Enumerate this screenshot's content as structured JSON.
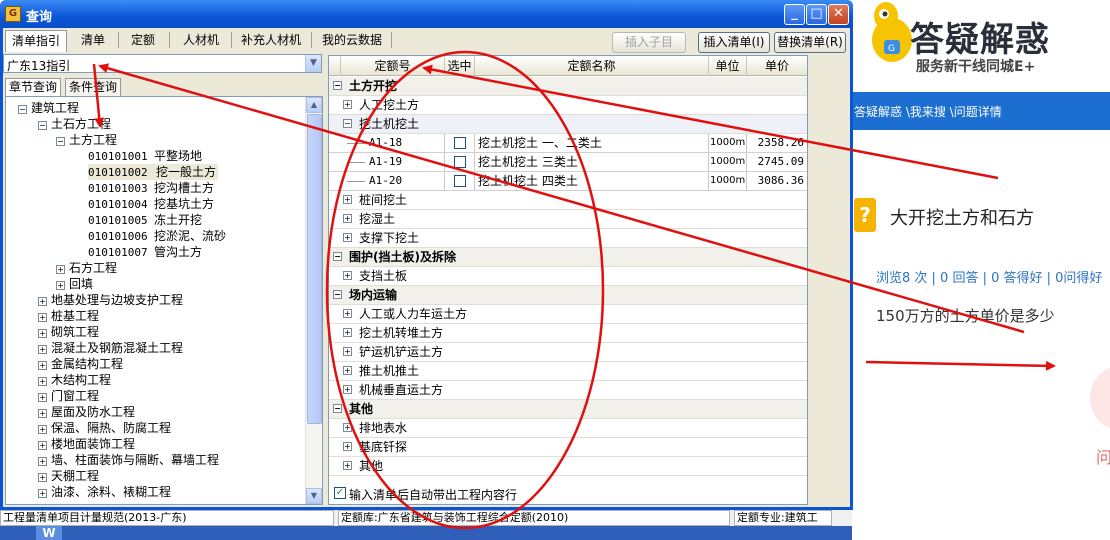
{
  "window": {
    "title": "查询"
  },
  "toolbar": {
    "tabs": [
      "清单指引",
      "清单",
      "定额",
      "人材机",
      "补充人材机",
      "我的云数据"
    ],
    "insert_child": "插入子目",
    "insert_list": "插入清单(I)",
    "replace_list": "替换清单(R)"
  },
  "left": {
    "guide_select": "广东13指引",
    "subtabs": [
      "章节查询",
      "条件查询"
    ],
    "tree": [
      {
        "text": "建筑工程",
        "exp": "−",
        "indent": 0
      },
      {
        "text": "土石方工程",
        "exp": "−",
        "indent": 1
      },
      {
        "text": "土方工程",
        "exp": "−",
        "indent": 2
      },
      {
        "code": "010101001",
        "text": "平整场地",
        "indent": 3
      },
      {
        "code": "010101002",
        "text": "挖一般土方",
        "indent": 3,
        "selected": true
      },
      {
        "code": "010101003",
        "text": "挖沟槽土方",
        "indent": 3
      },
      {
        "code": "010101004",
        "text": "挖基坑土方",
        "indent": 3
      },
      {
        "code": "010101005",
        "text": "冻土开挖",
        "indent": 3
      },
      {
        "code": "010101006",
        "text": "挖淤泥、流砂",
        "indent": 3
      },
      {
        "code": "010101007",
        "text": "管沟土方",
        "indent": 3
      },
      {
        "text": "石方工程",
        "exp": "+",
        "indent": 2
      },
      {
        "text": "回填",
        "exp": "+",
        "indent": 2
      },
      {
        "text": "地基处理与边坡支护工程",
        "exp": "+",
        "indent": 1
      },
      {
        "text": "桩基工程",
        "exp": "+",
        "indent": 1
      },
      {
        "text": "砌筑工程",
        "exp": "+",
        "indent": 1
      },
      {
        "text": "混凝土及钢筋混凝土工程",
        "exp": "+",
        "indent": 1
      },
      {
        "text": "金属结构工程",
        "exp": "+",
        "indent": 1
      },
      {
        "text": "木结构工程",
        "exp": "+",
        "indent": 1
      },
      {
        "text": "门窗工程",
        "exp": "+",
        "indent": 1
      },
      {
        "text": "屋面及防水工程",
        "exp": "+",
        "indent": 1
      },
      {
        "text": "保温、隔热、防腐工程",
        "exp": "+",
        "indent": 1
      },
      {
        "text": "楼地面装饰工程",
        "exp": "+",
        "indent": 1
      },
      {
        "text": "墙、柱面装饰与隔断、幕墙工程",
        "exp": "+",
        "indent": 1
      },
      {
        "text": "天棚工程",
        "exp": "+",
        "indent": 1
      },
      {
        "text": "油漆、涂料、裱糊工程",
        "exp": "+",
        "indent": 1
      }
    ]
  },
  "grid": {
    "headers": [
      "定额号",
      "选中",
      "定额名称",
      "单位",
      "单价"
    ],
    "rows": [
      {
        "type": "group",
        "exp": "−",
        "text": "土方开挖"
      },
      {
        "type": "sub",
        "exp": "+",
        "text": "人工挖土方"
      },
      {
        "type": "sub",
        "exp": "−",
        "text": "挖土机挖土",
        "highlight": true
      },
      {
        "type": "item",
        "code": "A1-18",
        "name": "挖土机挖土 一、二类土",
        "unit": "1000m3",
        "price": "2358.26"
      },
      {
        "type": "item",
        "code": "A1-19",
        "name": "挖土机挖土 三类土",
        "unit": "1000m3",
        "price": "2745.09"
      },
      {
        "type": "item",
        "code": "A1-20",
        "name": "挖土机挖土 四类土",
        "unit": "1000m3",
        "price": "3086.36"
      },
      {
        "type": "sub",
        "exp": "+",
        "text": "桩间挖土"
      },
      {
        "type": "sub",
        "exp": "+",
        "text": "挖湿土"
      },
      {
        "type": "sub",
        "exp": "+",
        "text": "支撑下挖土"
      },
      {
        "type": "group",
        "exp": "−",
        "text": "围护(挡土板)及拆除"
      },
      {
        "type": "sub",
        "exp": "+",
        "text": "支挡土板"
      },
      {
        "type": "group",
        "exp": "−",
        "text": "场内运输"
      },
      {
        "type": "sub",
        "exp": "+",
        "text": "人工或人力车运土方"
      },
      {
        "type": "sub",
        "exp": "+",
        "text": "挖土机转堆土方"
      },
      {
        "type": "sub",
        "exp": "+",
        "text": "铲运机铲运土方"
      },
      {
        "type": "sub",
        "exp": "+",
        "text": "推土机推土"
      },
      {
        "type": "sub",
        "exp": "+",
        "text": "机械垂直运土方"
      },
      {
        "type": "group",
        "exp": "−",
        "text": "其他"
      },
      {
        "type": "sub",
        "exp": "+",
        "text": "排地表水"
      },
      {
        "type": "sub",
        "exp": "+",
        "text": "基底钎探"
      },
      {
        "type": "sub",
        "exp": "+",
        "text": "其他"
      }
    ],
    "auto_option": "输入清单后自动带出工程内容行"
  },
  "bottom": {
    "cell1": "工程量清单项目计量规范(2013-广东)",
    "cell2": "定额库:广东省建筑与装饰工程综合定额(2010)",
    "cell3": "定额专业:建筑工"
  },
  "background_page": {
    "logo_title": "答疑解惑",
    "logo_sub": "服务新干线同城E+",
    "breadcrumb": "答疑解惑 \\我来搜 \\问题详情",
    "question_title": "大开挖土方和石方",
    "stats": "浏览8 次 | 0 回答 | 0 答得好 | 0问得好",
    "question_text": "150万方的土方单价是多少",
    "ask_char": "问"
  },
  "colors": {
    "titlebar": "#0a56d8",
    "annotation_red": "#e01010",
    "web_nav": "#1c6fd1"
  }
}
